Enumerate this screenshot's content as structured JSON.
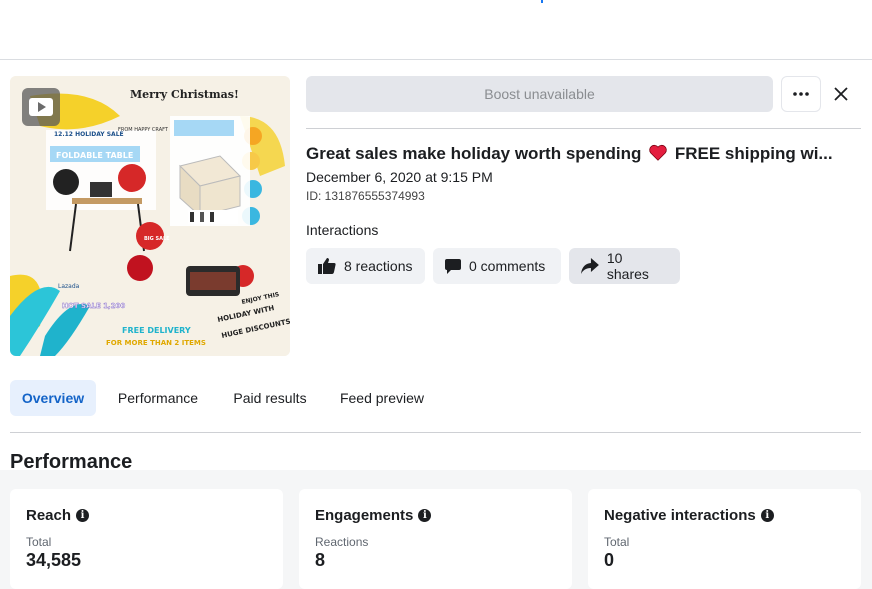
{
  "post": {
    "boost_label": "Boost unavailable",
    "title": "Great sales make holiday worth spending ❤️ FREE shipping wi...",
    "title_text_before": "Great sales make holiday worth spending",
    "title_text_after": "FREE shipping wi...",
    "date": "December 6, 2020 at 9:15 PM",
    "id_text": "ID: 131876555374993",
    "interactions_label": "Interactions",
    "reactions": "8 reactions",
    "comments": "0 comments",
    "shares": "10 shares"
  },
  "media": {
    "header": "Merry Christmas!",
    "sub": "FROM HAPPY CRAFT",
    "sale_tag": "12.12 HOLIDAY SALE",
    "banner": "FOLDABLE TABLE",
    "promo_line1": "FREE DELIVERY",
    "promo_line2": "FOR MORE THAN 2 ITEMS",
    "right_text1": "ENJOY THIS",
    "right_text2": "HOLIDAY WITH",
    "right_text3": "HUGE DISCOUNTS",
    "hot_sale": "HOT SALE 1,200",
    "brand": "Lazada",
    "big_sale": "BIG SALE"
  },
  "tabs": [
    {
      "label": "Overview",
      "active": true
    },
    {
      "label": "Performance",
      "active": false
    },
    {
      "label": "Paid results",
      "active": false
    },
    {
      "label": "Feed preview",
      "active": false
    }
  ],
  "performance": {
    "heading": "Performance",
    "cards": [
      {
        "title": "Reach",
        "label": "Total",
        "value": "34,585"
      },
      {
        "title": "Engagements",
        "label": "Reactions",
        "value": "8"
      },
      {
        "title": "Negative interactions",
        "label": "Total",
        "value": "0"
      }
    ]
  },
  "colors": {
    "accent_blue": "#1877f2",
    "active_tab_bg": "#e7f0fd",
    "active_tab_text": "#1464c8",
    "heart_red": "#e41e3f"
  },
  "icons": [
    "play-icon",
    "more-icon",
    "close-icon",
    "like-icon",
    "comment-icon",
    "share-icon",
    "heart-icon",
    "info-icon"
  ]
}
